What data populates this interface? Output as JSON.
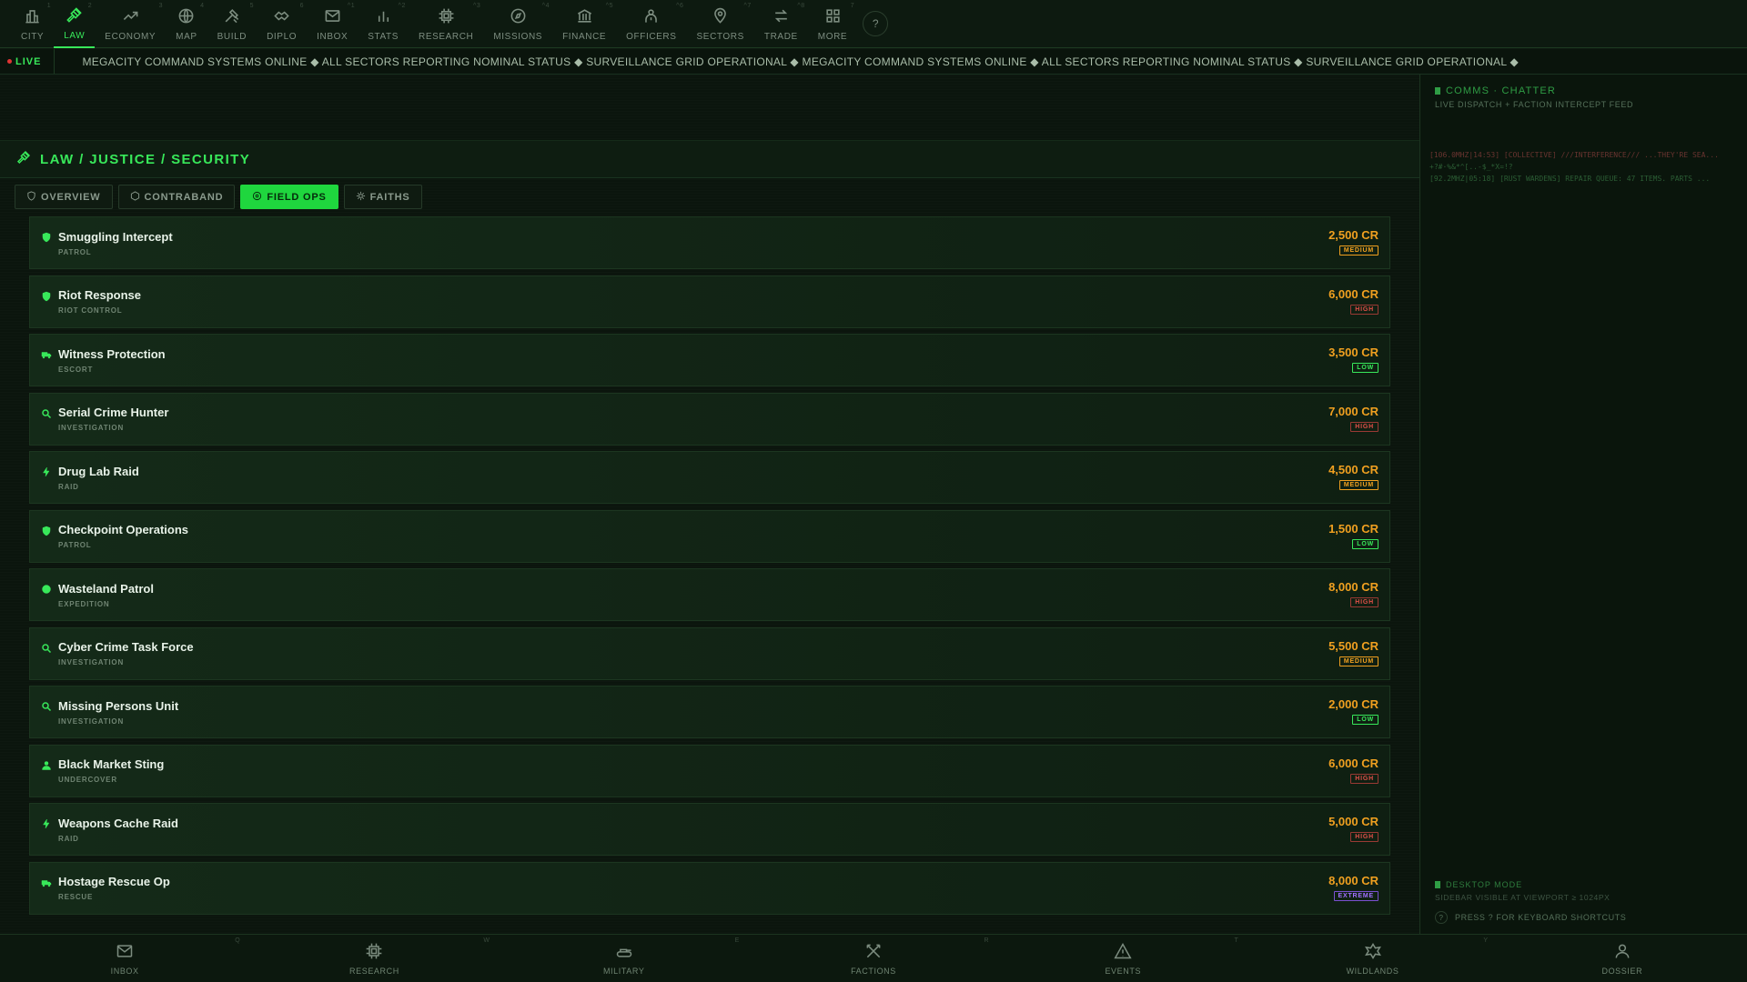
{
  "topnav": {
    "items": [
      {
        "label": "CITY",
        "icon": "city-icon",
        "num": "1",
        "active": false
      },
      {
        "label": "LAW",
        "icon": "gavel-icon",
        "num": "2",
        "active": true
      },
      {
        "label": "ECONOMY",
        "icon": "trend-icon",
        "num": "3",
        "active": false
      },
      {
        "label": "MAP",
        "icon": "globe-icon",
        "num": "4",
        "active": false
      },
      {
        "label": "BUILD",
        "icon": "hammer-icon",
        "num": "5",
        "active": false
      },
      {
        "label": "DIPLO",
        "icon": "handshake-icon",
        "num": "6",
        "active": false
      },
      {
        "label": "INBOX",
        "icon": "mail-icon",
        "num": "^1",
        "active": false
      },
      {
        "label": "STATS",
        "icon": "bar-chart-icon",
        "num": "^2",
        "active": false
      },
      {
        "label": "RESEARCH",
        "icon": "chip-icon",
        "num": "^3",
        "active": false
      },
      {
        "label": "MISSIONS",
        "icon": "compass-icon",
        "num": "^4",
        "active": false
      },
      {
        "label": "FINANCE",
        "icon": "bank-icon",
        "num": "^5",
        "active": false
      },
      {
        "label": "OFFICERS",
        "icon": "officers-icon",
        "num": "^6",
        "active": false
      },
      {
        "label": "SECTORS",
        "icon": "pin-icon",
        "num": "^7",
        "active": false
      },
      {
        "label": "TRADE",
        "icon": "swap-icon",
        "num": "^8",
        "active": false
      },
      {
        "label": "MORE",
        "icon": "grid-icon",
        "num": "7",
        "active": false
      }
    ],
    "help_label": "?"
  },
  "ticker": {
    "live_label": "LIVE",
    "text": "MEGACITY COMMAND SYSTEMS ONLINE ◆ ALL SECTORS REPORTING NOMINAL STATUS ◆ SURVEILLANCE GRID OPERATIONAL ◆ MEGACITY COMMAND SYSTEMS ONLINE ◆ ALL SECTORS REPORTING NOMINAL STATUS ◆ SURVEILLANCE GRID OPERATIONAL ◆"
  },
  "section": {
    "title": "LAW / JUSTICE / SECURITY",
    "tabs": [
      {
        "label": "OVERVIEW",
        "active": false
      },
      {
        "label": "CONTRABAND",
        "active": false
      },
      {
        "label": "FIELD OPS",
        "active": true
      },
      {
        "label": "FAITHS",
        "active": false
      }
    ]
  },
  "ops": [
    {
      "name": "Smuggling Intercept",
      "type": "PATROL",
      "reward": "2,500 CR",
      "risk": "MEDIUM",
      "icon": "shield-icon"
    },
    {
      "name": "Riot Response",
      "type": "RIOT CONTROL",
      "reward": "6,000 CR",
      "risk": "HIGH",
      "icon": "shield-icon"
    },
    {
      "name": "Witness Protection",
      "type": "ESCORT",
      "reward": "3,500 CR",
      "risk": "LOW",
      "icon": "truck-icon"
    },
    {
      "name": "Serial Crime Hunter",
      "type": "INVESTIGATION",
      "reward": "7,000 CR",
      "risk": "HIGH",
      "icon": "magnifier-icon"
    },
    {
      "name": "Drug Lab Raid",
      "type": "RAID",
      "reward": "4,500 CR",
      "risk": "MEDIUM",
      "icon": "bolt-icon"
    },
    {
      "name": "Checkpoint Operations",
      "type": "PATROL",
      "reward": "1,500 CR",
      "risk": "LOW",
      "icon": "shield-icon"
    },
    {
      "name": "Wasteland Patrol",
      "type": "EXPEDITION",
      "reward": "8,000 CR",
      "risk": "HIGH",
      "icon": "compass-icon"
    },
    {
      "name": "Cyber Crime Task Force",
      "type": "INVESTIGATION",
      "reward": "5,500 CR",
      "risk": "MEDIUM",
      "icon": "magnifier-icon"
    },
    {
      "name": "Missing Persons Unit",
      "type": "INVESTIGATION",
      "reward": "2,000 CR",
      "risk": "LOW",
      "icon": "magnifier-icon"
    },
    {
      "name": "Black Market Sting",
      "type": "UNDERCOVER",
      "reward": "6,000 CR",
      "risk": "HIGH",
      "icon": "agent-icon"
    },
    {
      "name": "Weapons Cache Raid",
      "type": "RAID",
      "reward": "5,000 CR",
      "risk": "HIGH",
      "icon": "bolt-icon"
    },
    {
      "name": "Hostage Rescue Op",
      "type": "RESCUE",
      "reward": "8,000 CR",
      "risk": "EXTREME",
      "icon": "truck-icon"
    }
  ],
  "sidebar": {
    "title": "COMMS · CHATTER",
    "subtitle": "LIVE DISPATCH + FACTION INTERCEPT FEED",
    "feed": [
      {
        "text": "[106.0MHZ|14:53] [COLLECTIVE] ///INTERFERENCE/// ...THEY'RE SEA...",
        "tone": "red"
      },
      {
        "text": "+?#·%&*^[..-$_*X=!?",
        "tone": "green"
      },
      {
        "text": "[92.2MHZ|05:18] [RUST WARDENS] REPAIR QUEUE: 47 ITEMS. PARTS ...",
        "tone": "green"
      }
    ],
    "desktop_title": "DESKTOP MODE",
    "desktop_sub": "SIDEBAR VISIBLE AT VIEWPORT ≥ 1024PX",
    "shortcut_hint": "PRESS ? FOR KEYBOARD SHORTCUTS",
    "shortcut_key": "?"
  },
  "bottomnav": {
    "items": [
      {
        "label": "INBOX",
        "icon": "mail-icon",
        "num": "Q"
      },
      {
        "label": "RESEARCH",
        "icon": "chip-icon",
        "num": "W"
      },
      {
        "label": "MILITARY",
        "icon": "tank-icon",
        "num": "E"
      },
      {
        "label": "FACTIONS",
        "icon": "swords-icon",
        "num": "R"
      },
      {
        "label": "EVENTS",
        "icon": "warning-icon",
        "num": "T"
      },
      {
        "label": "WILDLANDS",
        "icon": "leaf-icon",
        "num": "Y"
      },
      {
        "label": "DOSSIER",
        "icon": "user-icon",
        "num": ""
      }
    ]
  },
  "colors": {
    "accent": "#38e85a",
    "reward": "#f0a020",
    "high": "#e05048",
    "extreme": "#a070ff"
  }
}
